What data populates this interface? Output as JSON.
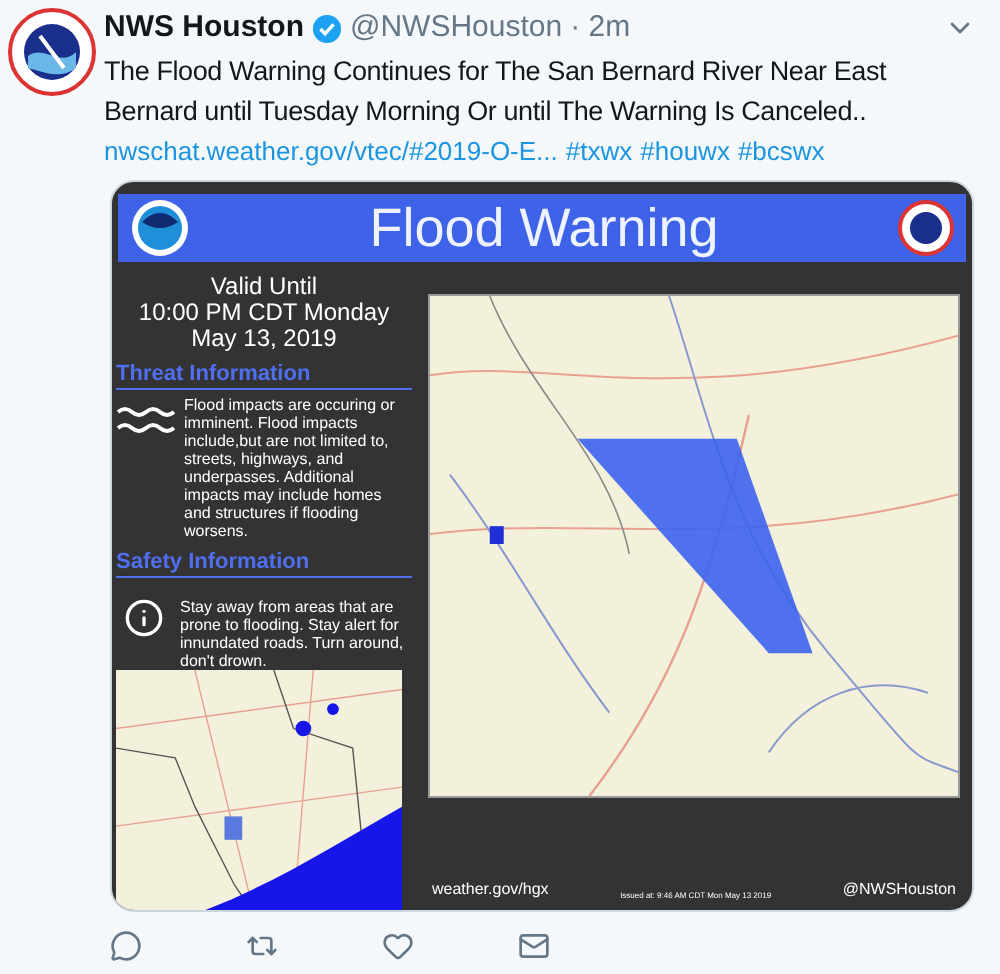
{
  "tweet": {
    "name": "NWS Houston",
    "verified": true,
    "handle": "@NWSHouston",
    "time": "· 2m",
    "text": "The Flood Warning Continues for The San Bernard River Near East Bernard until Tuesday Morning Or until The Warning Is Canceled..",
    "link": "nwschat.weather.gov/vtec/#2019-O-E...",
    "hashtags": [
      "#txwx",
      "#houwx",
      "#bcswx"
    ]
  },
  "graphic": {
    "title": "Flood Warning",
    "valid": [
      "Valid Until",
      "10:00 PM CDT Monday",
      "May 13, 2019"
    ],
    "sections": [
      {
        "heading": "Threat Information",
        "kind": "waves",
        "text": "Flood impacts are occuring or imminent. Flood impacts include,but are not limited to, streets, highways, and underpasses. Additional impacts may include homes and structures if flooding worsens."
      },
      {
        "heading": "Safety Information",
        "kind": "info",
        "text": "Stay away from areas that are prone to flooding. Stay alert for innundated roads. Turn around, don't drown."
      }
    ],
    "footer": {
      "site": "weather.gov/hgx",
      "issued": "Issued at: 9:46 AM CDT Mon May 13 2019",
      "handle": "@NWSHouston"
    }
  }
}
